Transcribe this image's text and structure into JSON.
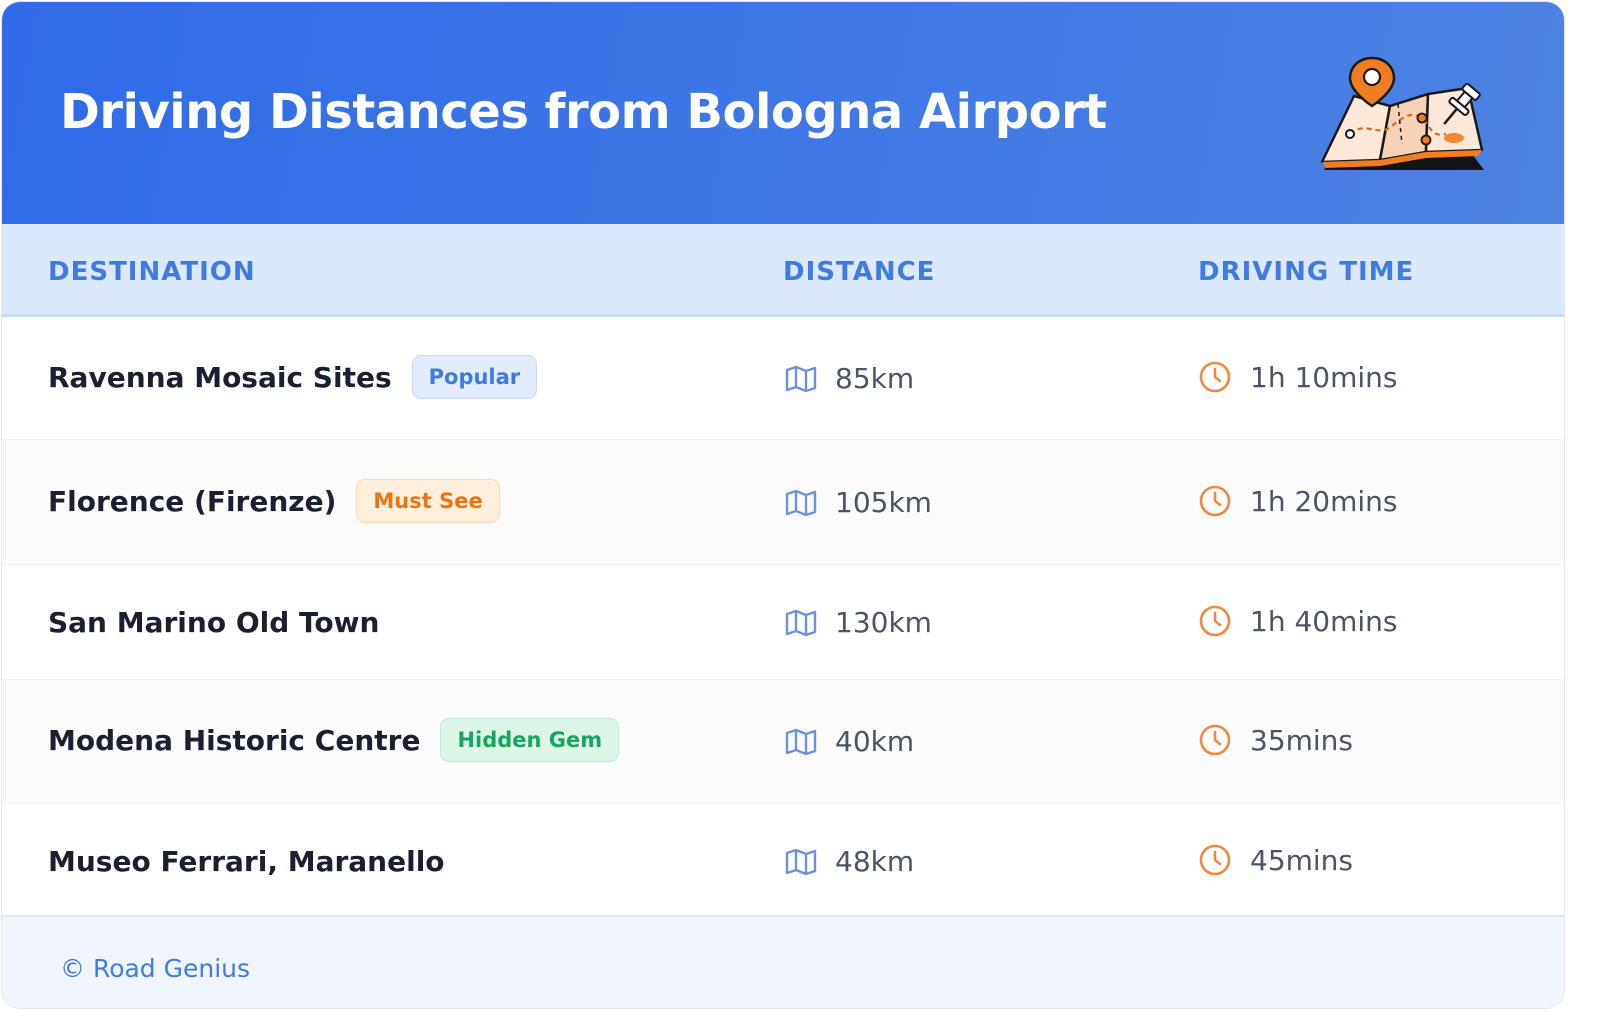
{
  "header": {
    "title": "Driving Distances from Bologna Airport",
    "illustration": "map-with-pins-icon",
    "gradient_start": "#2f6ae8",
    "gradient_end": "#4d82e2"
  },
  "table": {
    "columns": [
      "DESTINATION",
      "DISTANCE",
      "DRIVING TIME"
    ],
    "distance_icon": "folded-map-icon",
    "time_icon": "clock-icon",
    "rows": [
      {
        "destination": "Ravenna Mosaic Sites",
        "badge": "Popular",
        "badge_color": "blue",
        "distance": "85km",
        "time": "1h 10mins"
      },
      {
        "destination": "Florence (Firenze)",
        "badge": "Must See",
        "badge_color": "orange",
        "distance": "105km",
        "time": "1h 20mins"
      },
      {
        "destination": "San Marino Old Town",
        "badge": "",
        "badge_color": "",
        "distance": "130km",
        "time": "1h 40mins"
      },
      {
        "destination": "Modena Historic Centre",
        "badge": "Hidden Gem",
        "badge_color": "green",
        "distance": "40km",
        "time": "35mins"
      },
      {
        "destination": "Museo Ferrari, Maranello",
        "badge": "",
        "badge_color": "",
        "distance": "48km",
        "time": "45mins"
      }
    ]
  },
  "footer": {
    "credit": "© Road Genius"
  },
  "colors": {
    "accent": "#3f7be0",
    "badge_orange": "#ec7414",
    "badge_green": "#18a55e",
    "clock_orange": "#f0883e"
  }
}
